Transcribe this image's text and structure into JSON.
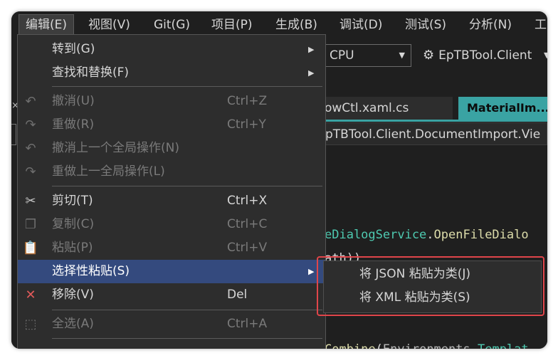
{
  "menubar": {
    "items": [
      {
        "label": "编辑(E)",
        "active": true
      },
      {
        "label": "视图(V)"
      },
      {
        "label": "Git(G)"
      },
      {
        "label": "项目(P)"
      },
      {
        "label": "生成(B)"
      },
      {
        "label": "调试(D)"
      },
      {
        "label": "测试(S)"
      },
      {
        "label": "分析(N)"
      },
      {
        "label": "工"
      }
    ]
  },
  "toolbar": {
    "platform": "CPU",
    "startup_project": "EpTBTool.Client"
  },
  "tabs": [
    {
      "label": "owCtl.xaml.cs"
    },
    {
      "label": "MaterialIm..."
    }
  ],
  "navbar": {
    "path": "pTBTool.Client.DocumentImport.Vie"
  },
  "code": {
    "line1": {
      "type": "eDialogService",
      "dot": ".",
      "method": "OpenFileDialo"
    },
    "line2": {
      "text": "ath))"
    },
    "line3": {
      "method": "Combine",
      "paren": "(",
      "id": "Environments",
      "dot": ".",
      "type": "Templat"
    }
  },
  "edit_menu": {
    "items": [
      {
        "label": "转到(G)",
        "submenu": true
      },
      {
        "label": "查找和替换(F)",
        "submenu": true
      },
      {
        "label": "撤消(U)",
        "shortcut": "Ctrl+Z",
        "icon": "undo-icon",
        "disabled": true
      },
      {
        "label": "重做(R)",
        "shortcut": "Ctrl+Y",
        "icon": "redo-icon",
        "disabled": true
      },
      {
        "label": "撤消上一个全局操作(N)",
        "icon": "undo-global-icon",
        "disabled": true
      },
      {
        "label": "重做上一全局操作(L)",
        "icon": "redo-global-icon",
        "disabled": true
      },
      {
        "label": "剪切(T)",
        "shortcut": "Ctrl+X",
        "icon": "scissors-icon"
      },
      {
        "label": "复制(C)",
        "shortcut": "Ctrl+C",
        "icon": "copy-icon",
        "disabled": true
      },
      {
        "label": "粘贴(P)",
        "shortcut": "Ctrl+V",
        "icon": "paste-icon",
        "disabled": true
      },
      {
        "label": "选择性粘贴(S)",
        "submenu": true,
        "highlight": true
      },
      {
        "label": "移除(V)",
        "shortcut": "Del",
        "icon": "delete-x-icon"
      },
      {
        "label": "全选(A)",
        "shortcut": "Ctrl+A",
        "icon": "select-all-icon",
        "disabled": true
      }
    ]
  },
  "paste_special_submenu": {
    "items": [
      {
        "label": "将 JSON 粘贴为类(J)"
      },
      {
        "label": "将 XML 粘贴为类(S)"
      }
    ]
  },
  "colors": {
    "menu_bg": "#2d2d2d",
    "highlight": "#344a7e",
    "tab_active": "#3aa3a3",
    "annotation_red": "#e0454a"
  }
}
